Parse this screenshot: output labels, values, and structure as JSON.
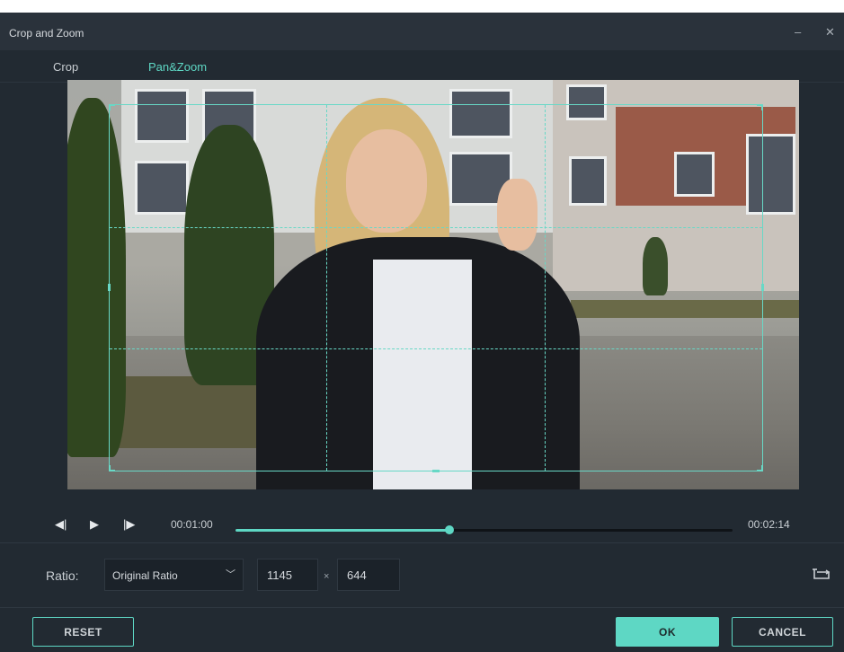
{
  "window": {
    "title": "Crop and Zoom",
    "minimize_icon": "minimize-icon",
    "close_icon": "close-icon"
  },
  "tabs": [
    {
      "label": "Crop",
      "active": false
    },
    {
      "label": "Pan&Zoom",
      "active": true
    }
  ],
  "playback": {
    "prev_frame_icon": "step-back-icon",
    "play_icon": "play-icon",
    "next_frame_icon": "step-forward-icon",
    "current_time": "00:01:00",
    "total_time": "00:02:14",
    "progress_fraction": 0.43
  },
  "ratio": {
    "label": "Ratio:",
    "selected": "Original Ratio",
    "width": "1145",
    "separator": "×",
    "height": "644",
    "swap_icon": "swap-aspect-icon"
  },
  "buttons": {
    "reset": "RESET",
    "ok": "OK",
    "cancel": "CANCEL"
  },
  "colors": {
    "accent": "#5ed7c4",
    "background": "#222a32",
    "titlebar": "#2a323b"
  }
}
